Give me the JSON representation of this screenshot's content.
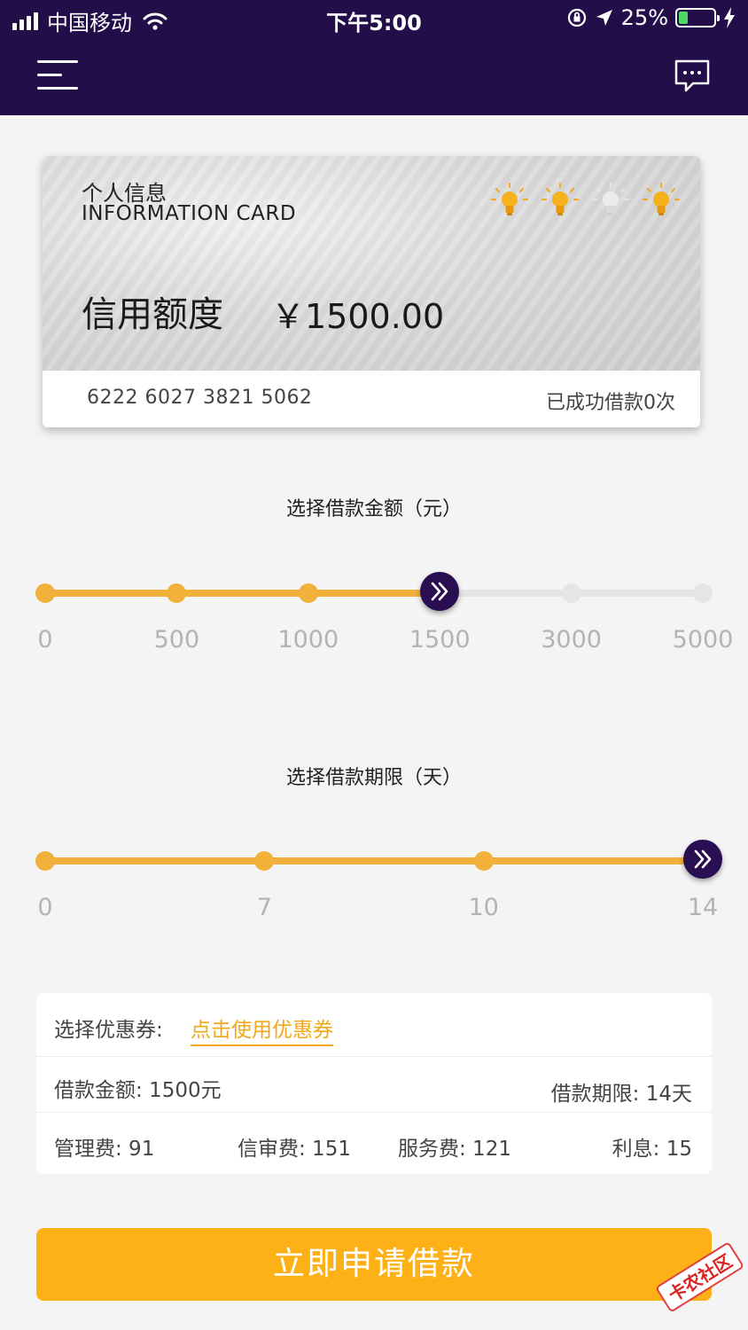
{
  "status_bar": {
    "carrier": "中国移动",
    "time": "下午5:00",
    "battery_percent": "25%"
  },
  "header": {
    "menu_icon": "menu-icon",
    "message_icon": "message-icon"
  },
  "card": {
    "title_cn": "个人信息",
    "title_en": "INFORMATION CARD",
    "credit_label": "信用额度",
    "credit_amount": "￥1500.00",
    "card_number": "6222 6027 3821 5062",
    "loan_count": "已成功借款0次",
    "credit_lights": {
      "lit": 3,
      "total": 4,
      "unlit_index": 2
    }
  },
  "amount_slider": {
    "title": "选择借款金额（元）",
    "options": [
      "0",
      "500",
      "1000",
      "1500",
      "3000",
      "5000"
    ],
    "selected": "1500",
    "selected_index": 3
  },
  "term_slider": {
    "title": "选择借款期限（天）",
    "options": [
      "0",
      "7",
      "10",
      "14"
    ],
    "selected": "14",
    "selected_index": 3
  },
  "summary": {
    "coupon_label": "选择优惠券:",
    "coupon_link": "点击使用优惠券",
    "loan_amount": "借款金额: 1500元",
    "loan_term": "借款期限: 14天",
    "management_fee": "管理费: 91",
    "review_fee": "信审费: 151",
    "service_fee": "服务费: 121",
    "interest": "利息: 15"
  },
  "apply_button": "立即申请借款",
  "watermark": "卡农社区",
  "colors": {
    "header_bg": "#230e4a",
    "accent": "#fdb117",
    "track_active": "#f2b13a",
    "track_inactive": "#e5e5e5",
    "handle": "#2a0e52"
  }
}
